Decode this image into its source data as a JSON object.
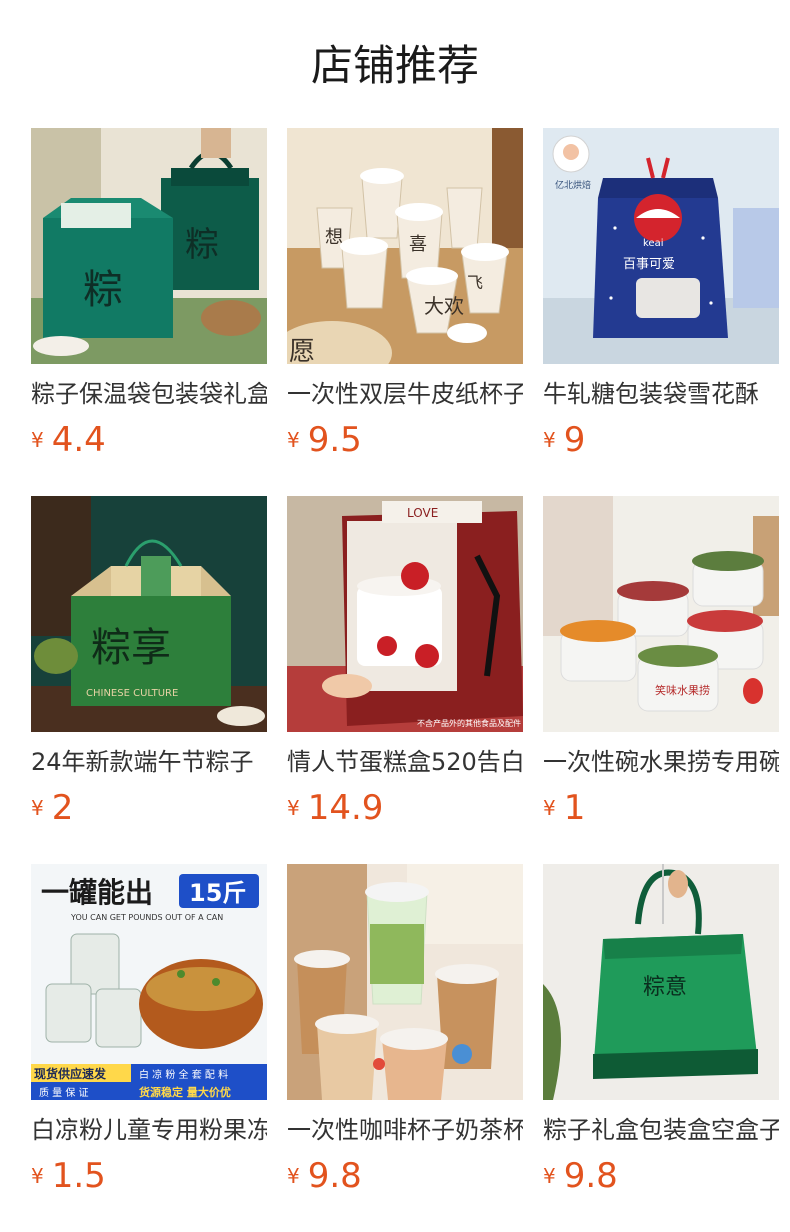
{
  "page_title": "店铺推荐",
  "colors": {
    "price": "#e2531e",
    "text": "#333333"
  },
  "products": [
    {
      "name": "粽子保温袋包装袋礼盒",
      "currency": "¥",
      "price": "4.4",
      "image_icon": "zongzi-green-insulated-bag-image"
    },
    {
      "name": "一次性双层牛皮纸杯子",
      "currency": "¥",
      "price": "9.5",
      "image_icon": "kraft-paper-cups-image"
    },
    {
      "name": "牛轧糖包装袋雪花酥",
      "currency": "¥",
      "price": "9",
      "image_icon": "nougat-blue-bag-image",
      "image_text": {
        "brand": "亿北烘焙",
        "word": "keai",
        "slogan": "百事可爱"
      }
    },
    {
      "name": "24年新款端午节粽子",
      "currency": "¥",
      "price": "2",
      "image_icon": "zongzi-bamboo-gift-box-image",
      "image_text": {
        "big": "粽享",
        "sub": "CHINESE CULTURE"
      }
    },
    {
      "name": "情人节蛋糕盒520告白",
      "currency": "¥",
      "price": "14.9",
      "image_icon": "valentine-cake-box-image",
      "image_text": {
        "brand": "LOVE",
        "note": "不含产品外的其他食品及配件"
      }
    },
    {
      "name": "一次性碗水果捞专用碗",
      "currency": "¥",
      "price": "1",
      "image_icon": "fruit-salad-bowls-image",
      "image_text": {
        "label": "笑味水果捞"
      }
    },
    {
      "name": "白凉粉儿童专用粉果冻",
      "currency": "¥",
      "price": "1.5",
      "image_icon": "white-jelly-powder-image",
      "image_text": {
        "headline": "一罐能出",
        "badge": "15斤",
        "sub": "YOU CAN GET POUNDS OUT OF A CAN",
        "left_top": "现货供应速发",
        "left_bottom": "质 量 保 证",
        "right_top": "白 凉 粉 全 套 配 料",
        "right_bottom": "货源稳定 量大价优"
      }
    },
    {
      "name": "一次性咖啡杯子奶茶杯",
      "currency": "¥",
      "price": "9.8",
      "image_icon": "plastic-coffee-cups-image"
    },
    {
      "name": "粽子礼盒包装盒空盒子",
      "currency": "¥",
      "price": "9.8",
      "image_icon": "green-zongzi-tote-bag-image",
      "image_text": {
        "label": "粽意"
      }
    }
  ]
}
